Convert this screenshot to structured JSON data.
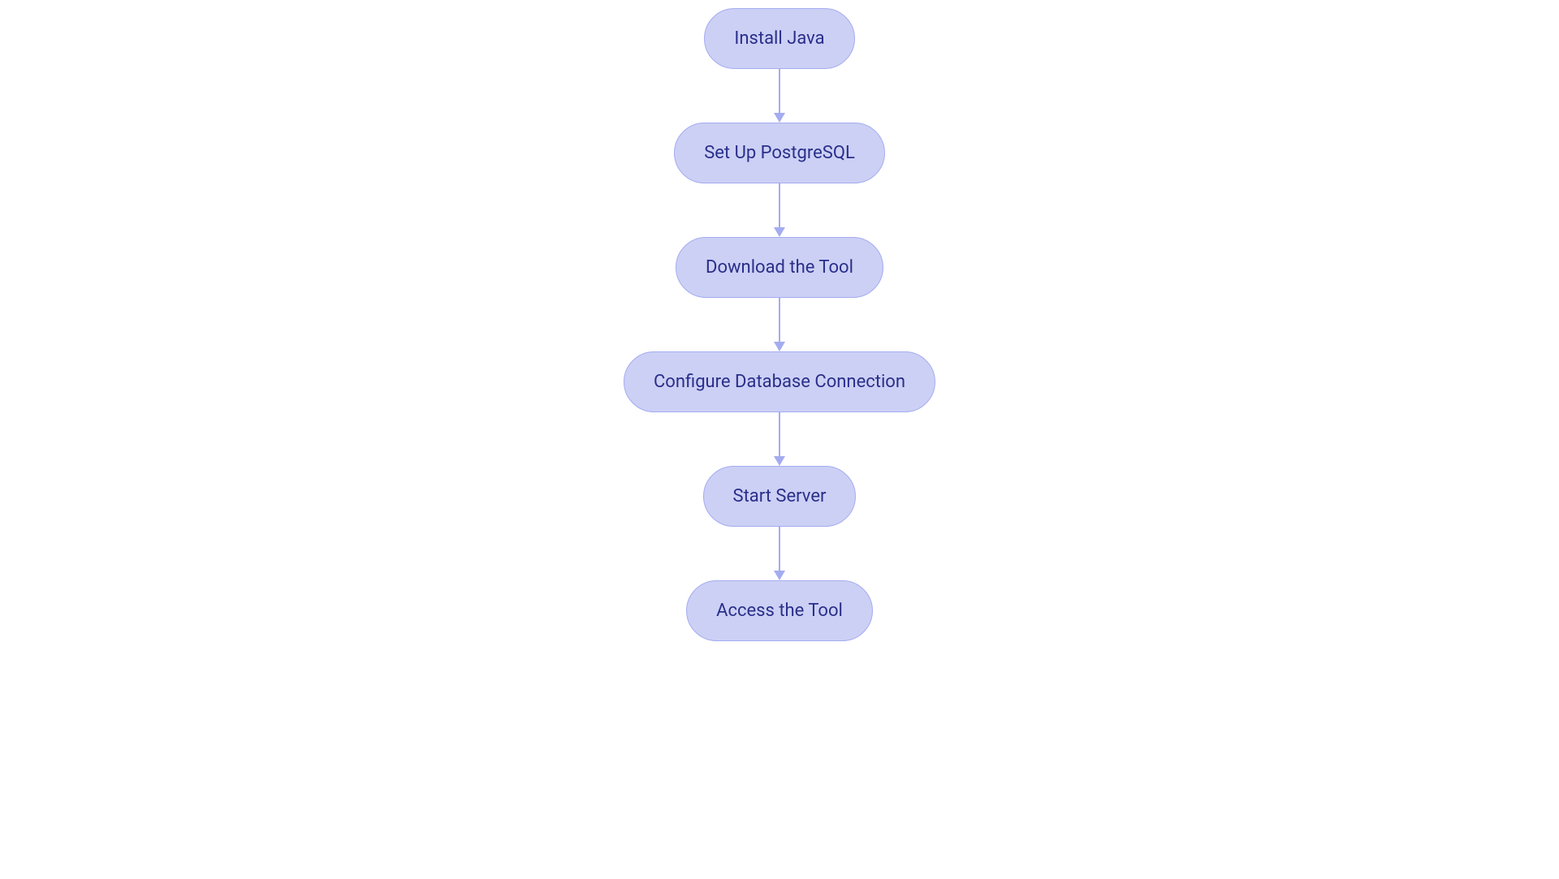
{
  "flowchart": {
    "nodes": [
      {
        "label": "Install Java"
      },
      {
        "label": "Set Up PostgreSQL"
      },
      {
        "label": "Download the Tool"
      },
      {
        "label": "Configure Database Connection"
      },
      {
        "label": "Start Server"
      },
      {
        "label": "Access the Tool"
      }
    ],
    "colors": {
      "node_fill": "#ccd0f5",
      "node_border": "#a4acf0",
      "text": "#2a2f8a",
      "arrow": "#a4acf0"
    }
  }
}
